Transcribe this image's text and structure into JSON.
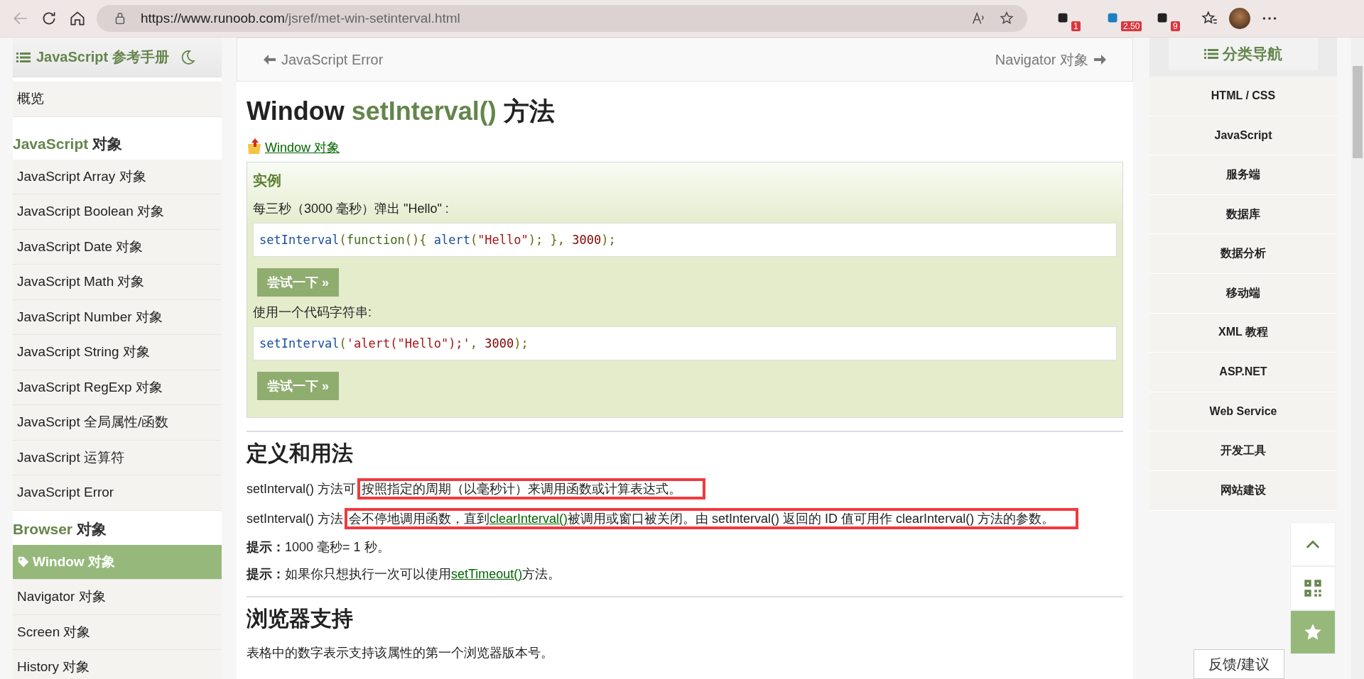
{
  "browser": {
    "url_host": "https://www.runoob.com",
    "url_path": "/jsref/met-win-setinterval.html",
    "extension_badges": [
      "1",
      "2.50",
      "9"
    ]
  },
  "sidebar": {
    "title": "JavaScript 参考手册",
    "overview": "概览",
    "sections": [
      {
        "name": "JavaScript",
        "suffix": "对象",
        "items": [
          {
            "label": "JavaScript Array 对象",
            "selected": false
          },
          {
            "label": "JavaScript Boolean 对象",
            "selected": false
          },
          {
            "label": "JavaScript Date 对象",
            "selected": false
          },
          {
            "label": "JavaScript Math 对象",
            "selected": false
          },
          {
            "label": "JavaScript Number 对象",
            "selected": false
          },
          {
            "label": "JavaScript String 对象",
            "selected": false
          },
          {
            "label": "JavaScript RegExp 对象",
            "selected": false
          },
          {
            "label": "JavaScript 全局属性/函数",
            "selected": false
          },
          {
            "label": "JavaScript 运算符",
            "selected": false
          },
          {
            "label": "JavaScript Error",
            "selected": false
          }
        ]
      },
      {
        "name": "Browser",
        "suffix": "对象",
        "items": [
          {
            "label": "Window 对象",
            "selected": true
          },
          {
            "label": "Navigator 对象",
            "selected": false
          },
          {
            "label": "Screen 对象",
            "selected": false
          },
          {
            "label": "History 对象",
            "selected": false
          }
        ]
      }
    ]
  },
  "main": {
    "prev": "JavaScript Error",
    "next": "Navigator 对象",
    "title": {
      "before": "Window",
      "name": "setInterval()",
      "after": "方法"
    },
    "parent_link": "Window 对象",
    "example": {
      "heading": "实例",
      "blocks": [
        {
          "description": "每三秒（3000 毫秒）弹出 \"Hello\" :",
          "code": [
            {
              "t": "setInterval",
              "kind": "fn"
            },
            {
              "t": "(",
              "kind": "punc"
            },
            {
              "t": "function",
              "kind": "kw"
            },
            {
              "t": "(){ ",
              "kind": "punc"
            },
            {
              "t": "alert",
              "kind": "fn"
            },
            {
              "t": "(",
              "kind": "punc"
            },
            {
              "t": "\"Hello\"",
              "kind": "str"
            },
            {
              "t": "); }, ",
              "kind": "punc"
            },
            {
              "t": "3000",
              "kind": "num"
            },
            {
              "t": ");",
              "kind": "punc"
            }
          ],
          "button": "尝试一下 »"
        },
        {
          "description": "使用一个代码字符串:",
          "code": [
            {
              "t": "setInterval",
              "kind": "fn"
            },
            {
              "t": "(",
              "kind": "punc"
            },
            {
              "t": "'alert(\"Hello\");'",
              "kind": "str"
            },
            {
              "t": ", ",
              "kind": "punc"
            },
            {
              "t": "3000",
              "kind": "num"
            },
            {
              "t": ");",
              "kind": "punc"
            }
          ],
          "button": "尝试一下 »"
        }
      ]
    },
    "definition": {
      "heading": "定义和用法",
      "paragraphs": [
        {
          "plain": "setInterval() 方法可",
          "highlighted": [
            {
              "t": "按照指定的周期（以毫秒计）来调用函数或计算表达式。",
              "kind": "text"
            }
          ]
        },
        {
          "plain": "setInterval() 方法",
          "highlighted": [
            {
              "t": "会不停地调用函数，直到",
              "kind": "text"
            },
            {
              "t": "clearInterval()",
              "kind": "link"
            },
            {
              "t": "被调用或窗口被关闭。由 setInterval() 返回的 ID 值可用作 clearInterval() 方法的参数。",
              "kind": "text"
            }
          ]
        }
      ],
      "tips": [
        {
          "label": "提示：",
          "parts": [
            {
              "t": "1000 毫秒= 1 秒。",
              "kind": "text"
            }
          ]
        },
        {
          "label": "提示：",
          "parts": [
            {
              "t": "如果你只想执行一次可以使用",
              "kind": "text"
            },
            {
              "t": "setTimeout()",
              "kind": "link"
            },
            {
              "t": "方法。",
              "kind": "text"
            }
          ]
        }
      ]
    },
    "support": {
      "heading": "浏览器支持",
      "text": "表格中的数字表示支持该属性的第一个浏览器版本号。"
    }
  },
  "right_nav": {
    "title": "分类导航",
    "items": [
      "HTML / CSS",
      "JavaScript",
      "服务端",
      "数据库",
      "数据分析",
      "移动端",
      "XML 教程",
      "ASP.NET",
      "Web Service",
      "开发工具",
      "网站建设"
    ],
    "feedback": "反馈/建议"
  }
}
